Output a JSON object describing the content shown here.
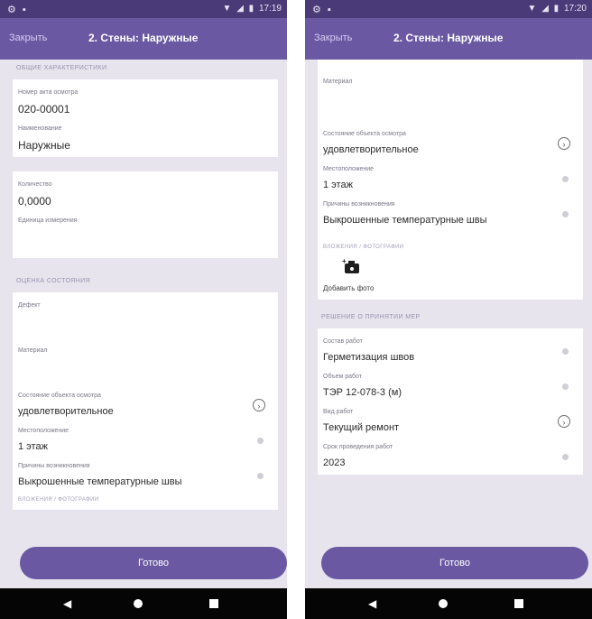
{
  "status": {
    "time": "17:19",
    "time_right": "17:20"
  },
  "header": {
    "close_label": "Закрыть",
    "title": "2. Стены: Наружные"
  },
  "left": {
    "general_header": "ОБЩИЕ ХАРАКТЕРИСТИКИ",
    "act_label": "Номер акта осмотра",
    "act_value": "020-00001",
    "name_label": "Наименование",
    "name_value": "Наружные",
    "qty_label": "Количество",
    "qty_value": "0,0000",
    "unit_label": "Единица измерения",
    "unit_value": "",
    "assessment_header": "ОЦЕНКА СОСТОЯНИЯ",
    "defect_label": "Дефект",
    "material_label": "Материал",
    "condition_label": "Состояние объекта осмотра",
    "condition_value": "удовлетворительное",
    "location_label": "Местоположение",
    "location_value": "1 этаж",
    "causes_label": "Причины возникновения",
    "causes_value": "Выкрошенные температурные швы",
    "photos_label": "ВЛОЖЕНИЯ / ФОТОГРАФИИ"
  },
  "right": {
    "material_label": "Материал",
    "condition_label": "Состояние объекта осмотра",
    "condition_value": "удовлетворительное",
    "location_label": "Местоположение",
    "location_value": "1 этаж",
    "causes_label": "Причины возникновения",
    "causes_value": "Выкрошенные температурные швы",
    "photos_label": "ВЛОЖЕНИЯ / ФОТОГРАФИИ",
    "add_photo_label": "Добавить фото",
    "decision_header": "РЕШЕНИЕ О ПРИНЯТИИ МЕР",
    "work_composition_label": "Состав работ",
    "work_composition_value": "Герметизация швов",
    "work_volume_label": "Объем работ",
    "work_volume_value": "ТЭР 12-078-3 (м)",
    "work_type_label": "Вид работ",
    "work_type_value": "Текущий ремонт",
    "deadline_label": "Срок проведения работ",
    "deadline_value": "2023"
  },
  "footer": {
    "done_label": "Готово"
  },
  "colors": {
    "primary": "#6a58a2",
    "statusbar": "#4a3a78",
    "background": "#e7e4ee"
  },
  "icons": [
    "wifi-icon",
    "signal-icon",
    "battery-icon",
    "chevron-right-icon",
    "camera-plus-icon",
    "back-icon",
    "home-icon",
    "recents-icon"
  ]
}
